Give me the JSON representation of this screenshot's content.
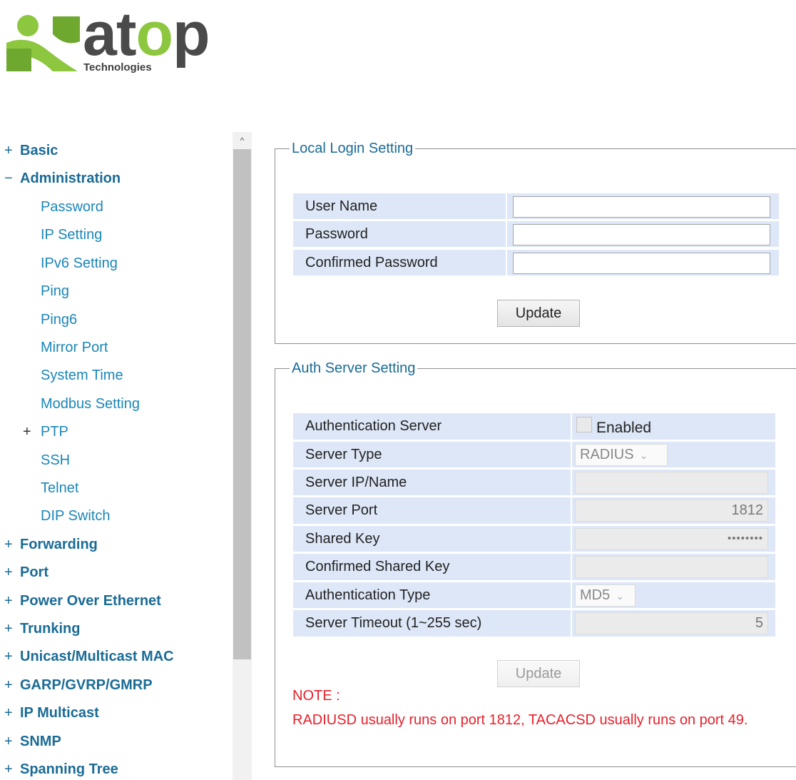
{
  "brand": {
    "word_a": "at",
    "word_o": "o",
    "word_p": "p",
    "tagline": "Technologies",
    "accent_color": "#8dc63f"
  },
  "sidebar": {
    "items": [
      {
        "sign": "+",
        "label": "Basic"
      },
      {
        "sign": "−",
        "label": "Administration"
      },
      {
        "label": "Password"
      },
      {
        "label": "IP Setting"
      },
      {
        "label": "IPv6 Setting"
      },
      {
        "label": "Ping"
      },
      {
        "label": "Ping6"
      },
      {
        "label": "Mirror Port"
      },
      {
        "label": "System Time"
      },
      {
        "label": "Modbus Setting"
      },
      {
        "sign": "+",
        "label": "PTP"
      },
      {
        "label": "SSH"
      },
      {
        "label": "Telnet"
      },
      {
        "label": "DIP Switch"
      },
      {
        "sign": "+",
        "label": "Forwarding"
      },
      {
        "sign": "+",
        "label": "Port"
      },
      {
        "sign": "+",
        "label": "Power Over Ethernet"
      },
      {
        "sign": "+",
        "label": "Trunking"
      },
      {
        "sign": "+",
        "label": "Unicast/Multicast MAC"
      },
      {
        "sign": "+",
        "label": "GARP/GVRP/GMRP"
      },
      {
        "sign": "+",
        "label": "IP Multicast"
      },
      {
        "sign": "+",
        "label": "SNMP"
      },
      {
        "sign": "+",
        "label": "Spanning Tree"
      }
    ],
    "scroll_up_glyph": "^"
  },
  "local_login": {
    "legend": "Local Login Setting",
    "user_name_label": "User Name",
    "user_name_value": "",
    "password_label": "Password",
    "password_value": "",
    "confirm_label": "Confirmed Password",
    "confirm_value": "",
    "update_label": "Update"
  },
  "auth_server": {
    "legend": "Auth Server Setting",
    "auth_server_label": "Authentication Server",
    "enabled_label": "Enabled",
    "enabled_checked": false,
    "server_type_label": "Server Type",
    "server_type_value": "RADIUS",
    "server_ip_label": "Server IP/Name",
    "server_ip_value": "",
    "server_port_label": "Server Port",
    "server_port_value": "1812",
    "shared_key_label": "Shared Key",
    "shared_key_value": "••••••••",
    "confirm_key_label": "Confirmed Shared Key",
    "confirm_key_value": "",
    "auth_type_label": "Authentication Type",
    "auth_type_value": "MD5",
    "timeout_label": "Server Timeout (1~255 sec)",
    "timeout_value": "5",
    "update_label": "Update",
    "dropdown_arrow": "⌄"
  },
  "note": {
    "title": "NOTE :",
    "text": "RADIUSD usually runs on port 1812, TACACSD usually runs on port 49."
  }
}
